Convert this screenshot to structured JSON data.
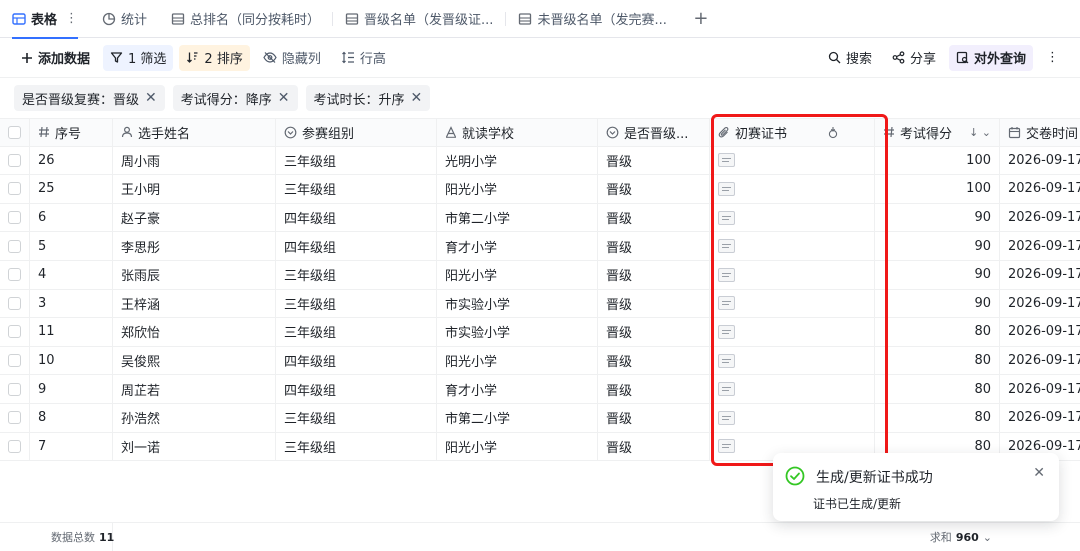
{
  "tabs": [
    {
      "label": "表格",
      "icon": "grid-table-icon",
      "active": true
    },
    {
      "label": "统计",
      "icon": "pie-chart-icon"
    },
    {
      "label": "总排名（同分按耗时）",
      "icon": "sheet-icon"
    },
    {
      "label": "晋级名单（发晋级证...",
      "icon": "sheet-icon"
    },
    {
      "label": "未晋级名单（发完赛...",
      "icon": "sheet-icon"
    }
  ],
  "toolbar": {
    "add_label": "添加数据",
    "filter_label": "1 筛选",
    "sort_label": "2 排序",
    "hide_label": "隐藏列",
    "rowheight_label": "行高",
    "search_label": "搜索",
    "share_label": "分享",
    "query_label": "对外查询"
  },
  "conditions": [
    "是否晋级复赛：晋级",
    "考试得分：降序",
    "考试时长：升序"
  ],
  "columns": {
    "no": "序号",
    "name": "选手姓名",
    "group": "参赛组别",
    "school": "就读学校",
    "adv": "是否晋级...",
    "cert": "初赛证书",
    "score": "考试得分",
    "time": "交卷时间"
  },
  "rows": [
    {
      "no": "26",
      "name": "周小雨",
      "group": "三年级组",
      "school": "光明小学",
      "adv": "晋级",
      "score": "100",
      "time": "2026-09-17"
    },
    {
      "no": "25",
      "name": "王小明",
      "group": "三年级组",
      "school": "阳光小学",
      "adv": "晋级",
      "score": "100",
      "time": "2026-09-17"
    },
    {
      "no": "6",
      "name": "赵子豪",
      "group": "四年级组",
      "school": "市第二小学",
      "adv": "晋级",
      "score": "90",
      "time": "2026-09-17"
    },
    {
      "no": "5",
      "name": "李思彤",
      "group": "四年级组",
      "school": "育才小学",
      "adv": "晋级",
      "score": "90",
      "time": "2026-09-17"
    },
    {
      "no": "4",
      "name": "张雨辰",
      "group": "三年级组",
      "school": "阳光小学",
      "adv": "晋级",
      "score": "90",
      "time": "2026-09-17"
    },
    {
      "no": "3",
      "name": "王梓涵",
      "group": "三年级组",
      "school": "市实验小学",
      "adv": "晋级",
      "score": "90",
      "time": "2026-09-17"
    },
    {
      "no": "11",
      "name": "郑欣怡",
      "group": "三年级组",
      "school": "市实验小学",
      "adv": "晋级",
      "score": "80",
      "time": "2026-09-17"
    },
    {
      "no": "10",
      "name": "吴俊熙",
      "group": "四年级组",
      "school": "阳光小学",
      "adv": "晋级",
      "score": "80",
      "time": "2026-09-17"
    },
    {
      "no": "9",
      "name": "周芷若",
      "group": "四年级组",
      "school": "育才小学",
      "adv": "晋级",
      "score": "80",
      "time": "2026-09-17"
    },
    {
      "no": "8",
      "name": "孙浩然",
      "group": "三年级组",
      "school": "市第二小学",
      "adv": "晋级",
      "score": "80",
      "time": "2026-09-17"
    },
    {
      "no": "7",
      "name": "刘一诺",
      "group": "三年级组",
      "school": "阳光小学",
      "adv": "晋级",
      "score": "80",
      "time": "2026-09-17"
    }
  ],
  "footer": {
    "count_label": "数据总数",
    "count": "11",
    "sum_label": "求和",
    "sum": "960"
  },
  "toast": {
    "title": "生成/更新证书成功",
    "message": "证书已生成/更新"
  },
  "colors": {
    "accent": "#3370ff",
    "highlight": "#f01818",
    "success": "#34c724"
  }
}
